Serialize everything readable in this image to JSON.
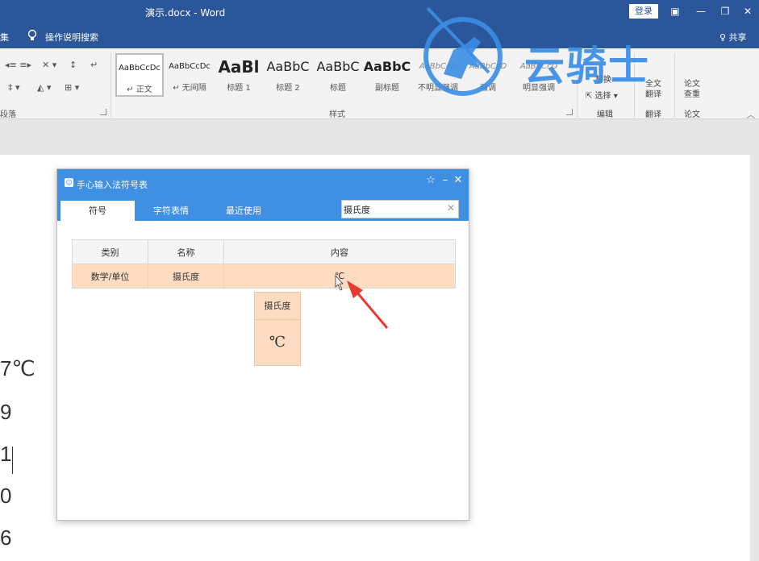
{
  "window": {
    "title": "演示.docx  -  Word",
    "login_label": "登录",
    "controls": [
      "▣",
      "—",
      "❐",
      "✕"
    ]
  },
  "tellbar": {
    "left_label": "集",
    "tell_me": "操作说明搜索",
    "share": "♀ 共享"
  },
  "ribbon": {
    "paragraph_label": "段落",
    "styles_label": "样式",
    "styles": [
      {
        "sample": "AaBbCcDc",
        "name": "↵ 正文"
      },
      {
        "sample": "AaBbCcDc",
        "name": "↵ 无间隔"
      },
      {
        "sample": "AaBl",
        "name": "标题 1"
      },
      {
        "sample": "AaBbC",
        "name": "标题 2"
      },
      {
        "sample": "AaBbC",
        "name": "标题"
      },
      {
        "sample": "AaBbC",
        "name": "副标题"
      },
      {
        "sample": "AaBbCcD",
        "name": "不明显强调"
      },
      {
        "sample": "AaBbCcD",
        "name": "强调"
      },
      {
        "sample": "AaBbCcD",
        "name": "明显强调"
      }
    ],
    "edit_items": [
      "替换",
      "选择 ▾"
    ],
    "edit_label": "编辑",
    "translate_button": "全文\n翻译",
    "translate_label": "翻译",
    "paper_button": "论文\n查重",
    "paper_label": "论文"
  },
  "watermark": {
    "text": "云骑士"
  },
  "document": {
    "lines": [
      "7℃",
      "9",
      "1",
      "0",
      "6"
    ]
  },
  "dialog": {
    "title": "手心输入法符号表",
    "tabs": [
      "符号",
      "字符表情",
      "最近使用"
    ],
    "active_tab": 0,
    "search_value": "摄氏度",
    "table": {
      "headers": [
        "类别",
        "名称",
        "内容"
      ],
      "rows": [
        {
          "category": "数学/单位",
          "name": "摄氏度",
          "content": "℃"
        }
      ]
    },
    "tooltip": {
      "name": "摄氏度",
      "symbol": "℃"
    }
  }
}
